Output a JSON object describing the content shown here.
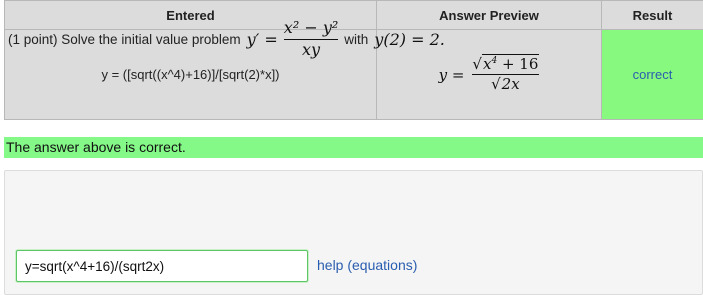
{
  "table": {
    "headers": {
      "entered": "Entered",
      "preview": "Answer Preview",
      "result": "Result"
    },
    "row": {
      "entered": "y = ([sqrt((x^4)+16)]/[sqrt(2)*x])",
      "preview": {
        "lhs": "y =",
        "num_base": "x",
        "num_exp": "4",
        "num_rest": "+ 16",
        "den_radicand": "2x"
      },
      "result": "correct"
    }
  },
  "status": {
    "message": "The answer above is correct."
  },
  "problem": {
    "points": "(1 point) Solve the initial value problem",
    "lhs": "y′ =",
    "num": "x² − y²",
    "den": "xy",
    "with_text": "with",
    "condition": "y(2) = 2."
  },
  "answer": {
    "value": "y=sqrt(x^4+16)/(sqrt2x)",
    "help_link": "help (equations)"
  },
  "colors": {
    "correct_bg": "#87f97f",
    "status_bg": "#85f988",
    "link": "#2a5db0",
    "header_bg": "#dcdcdc"
  }
}
